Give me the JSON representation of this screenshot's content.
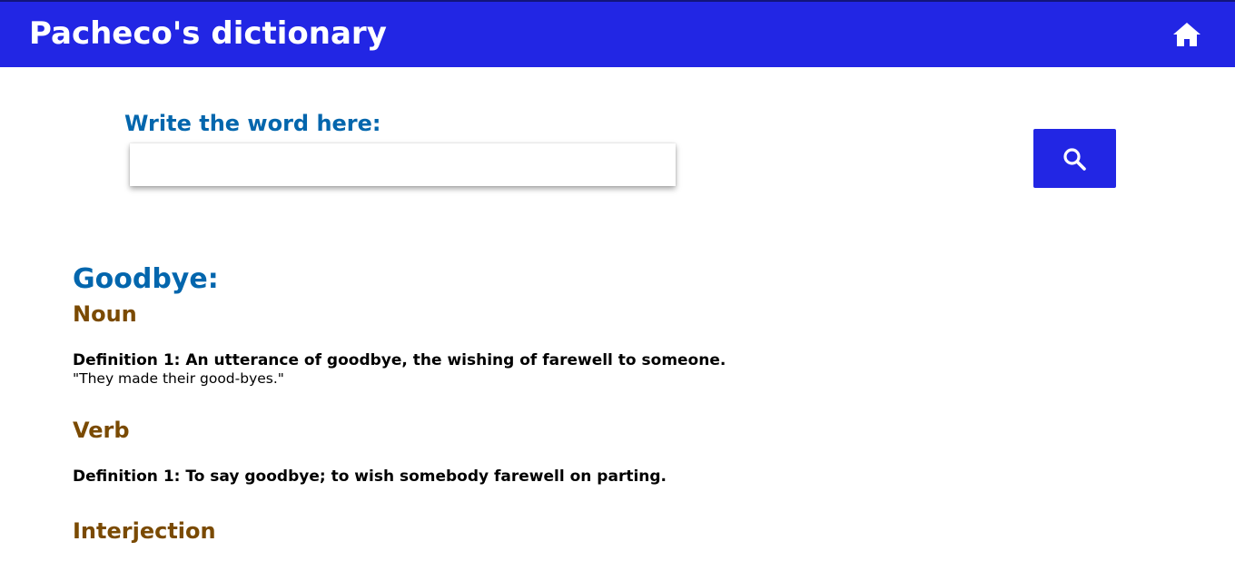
{
  "header": {
    "title": "Pacheco's dictionary",
    "home_icon": "home-icon",
    "background_color": "#2226e4"
  },
  "search": {
    "label": "Write the word here:",
    "value": "",
    "placeholder": "",
    "button_icon": "search-icon"
  },
  "result": {
    "word": "Goodbye:",
    "meanings": [
      {
        "part_of_speech": "Noun",
        "definitions": [
          {
            "text": "Definition 1: An utterance of goodbye, the wishing of farewell to someone.",
            "example": "\"They made their good-byes.\""
          }
        ]
      },
      {
        "part_of_speech": "Verb",
        "definitions": [
          {
            "text": "Definition 1: To say goodbye; to wish somebody farewell on parting.",
            "example": ""
          }
        ]
      },
      {
        "part_of_speech": "Interjection",
        "definitions": []
      }
    ]
  },
  "colors": {
    "accent": "#2226e4",
    "word_color": "#0366ad",
    "part_of_speech_color": "#7a4a02"
  }
}
